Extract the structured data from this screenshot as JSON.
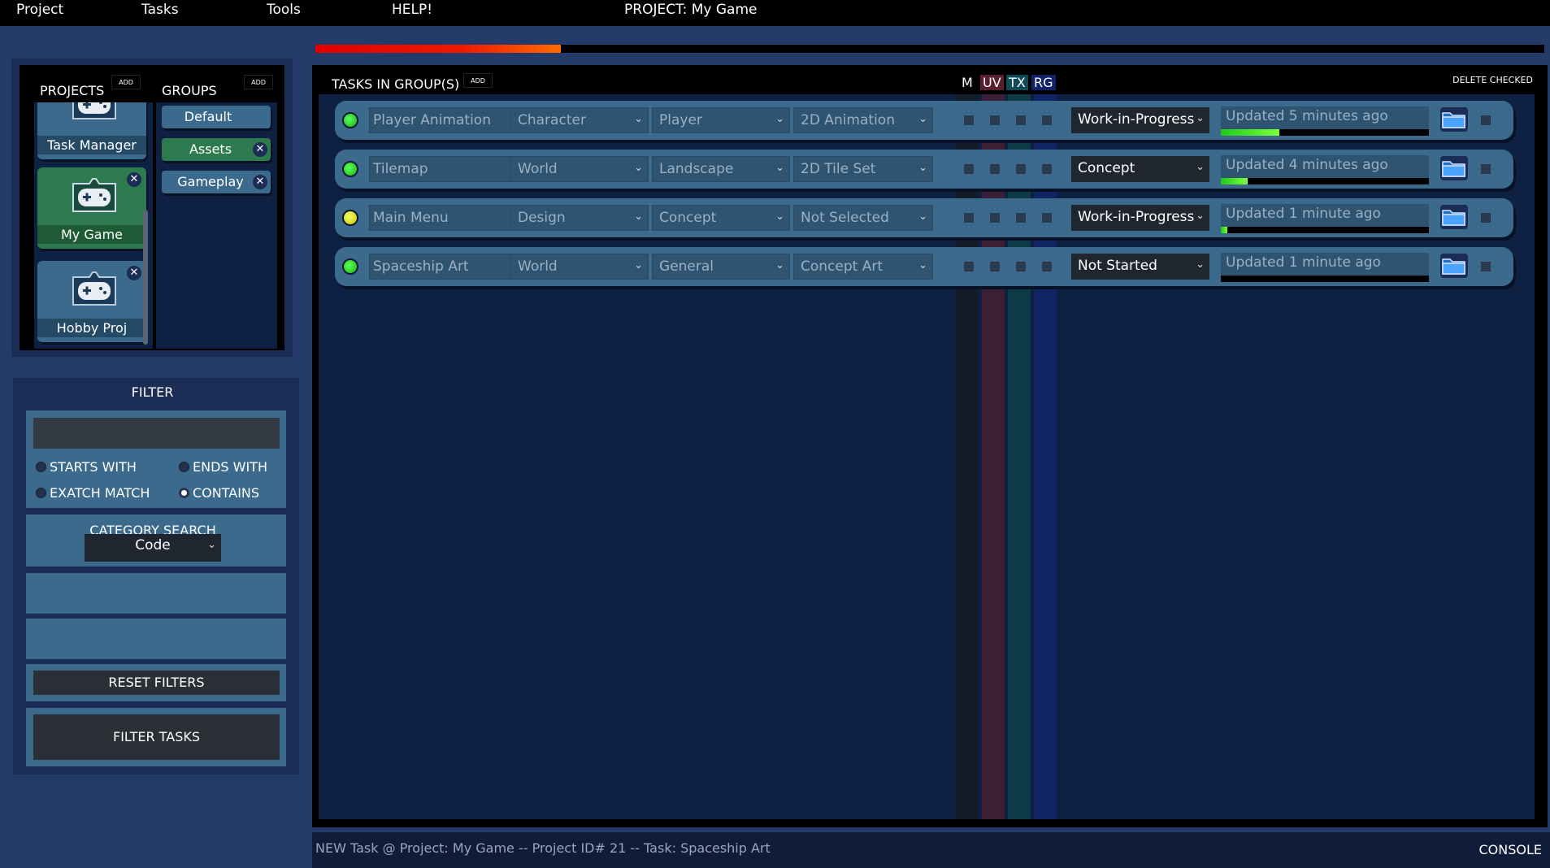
{
  "menu": {
    "project": "Project",
    "tasks": "Tasks",
    "tools": "Tools",
    "help": "HELP!"
  },
  "project_title": "PROJECT: My Game",
  "overall_progress": 0.2,
  "projects_panel": {
    "title": "PROJECTS",
    "add_label": "ADD",
    "items": [
      {
        "label": "Task Manager",
        "selected": false
      },
      {
        "label": "My Game",
        "selected": true
      },
      {
        "label": "Hobby Proj",
        "selected": false
      }
    ],
    "close_glyph": "✕"
  },
  "groups_panel": {
    "title": "GROUPS",
    "add_label": "ADD",
    "items": [
      {
        "label": "Default",
        "selected": false
      },
      {
        "label": "Assets",
        "selected": true
      },
      {
        "label": "Gameplay",
        "selected": false
      }
    ]
  },
  "filter": {
    "title": "FILTER",
    "search_value": "",
    "options": {
      "starts_with": "STARTS WITH",
      "ends_with": "ENDS WITH",
      "exact_match": "EXATCH MATCH",
      "contains": "CONTAINS"
    },
    "selected_option": "contains",
    "category_title": "CATEGORY SEARCH",
    "category_value": "Code",
    "reset_label": "RESET FILTERS",
    "filter_label": "FILTER TASKS"
  },
  "tasks": {
    "title": "TASKS IN GROUP(S)",
    "add_label": "ADD",
    "delete_checked_label": "DELETE CHECKED",
    "column_headers": {
      "m": "M",
      "uv": "UV",
      "tx": "TX",
      "rg": "RG"
    },
    "column_colors": {
      "m": "#141c2a",
      "uv": "#3a1f35",
      "tx": "#0f3a48",
      "rg": "#0f2563"
    },
    "rows": [
      {
        "status_color": "green",
        "name": "Player Animation",
        "category": "Character",
        "subcategory": "Player",
        "type": "2D Animation",
        "status": "Work-in-Progress",
        "updated": "Updated 5 minutes ago",
        "progress": 0.28
      },
      {
        "status_color": "green",
        "name": "Tilemap",
        "category": "World",
        "subcategory": "Landscape",
        "type": "2D Tile Set",
        "status": "Concept",
        "updated": "Updated 4 minutes ago",
        "progress": 0.13
      },
      {
        "status_color": "yellow",
        "name": "Main Menu",
        "category": "Design",
        "subcategory": "Concept",
        "type": "Not Selected",
        "status": "Work-in-Progress",
        "updated": "Updated 1 minute ago",
        "progress": 0.03
      },
      {
        "status_color": "green",
        "name": "Spaceship Art",
        "category": "World",
        "subcategory": "General",
        "type": "Concept Art",
        "status": "Not Started",
        "updated": "Updated 1 minute ago",
        "progress": 0
      }
    ]
  },
  "console": {
    "message": "NEW Task @ Project: My Game -- Project ID# 21 -- Task: Spaceship Art",
    "button_label": "CONSOLE"
  },
  "icons": {
    "gamepad": "gamepad-icon",
    "folder": "folder-icon",
    "chevron": "chevron-down-icon",
    "close": "close-icon"
  }
}
